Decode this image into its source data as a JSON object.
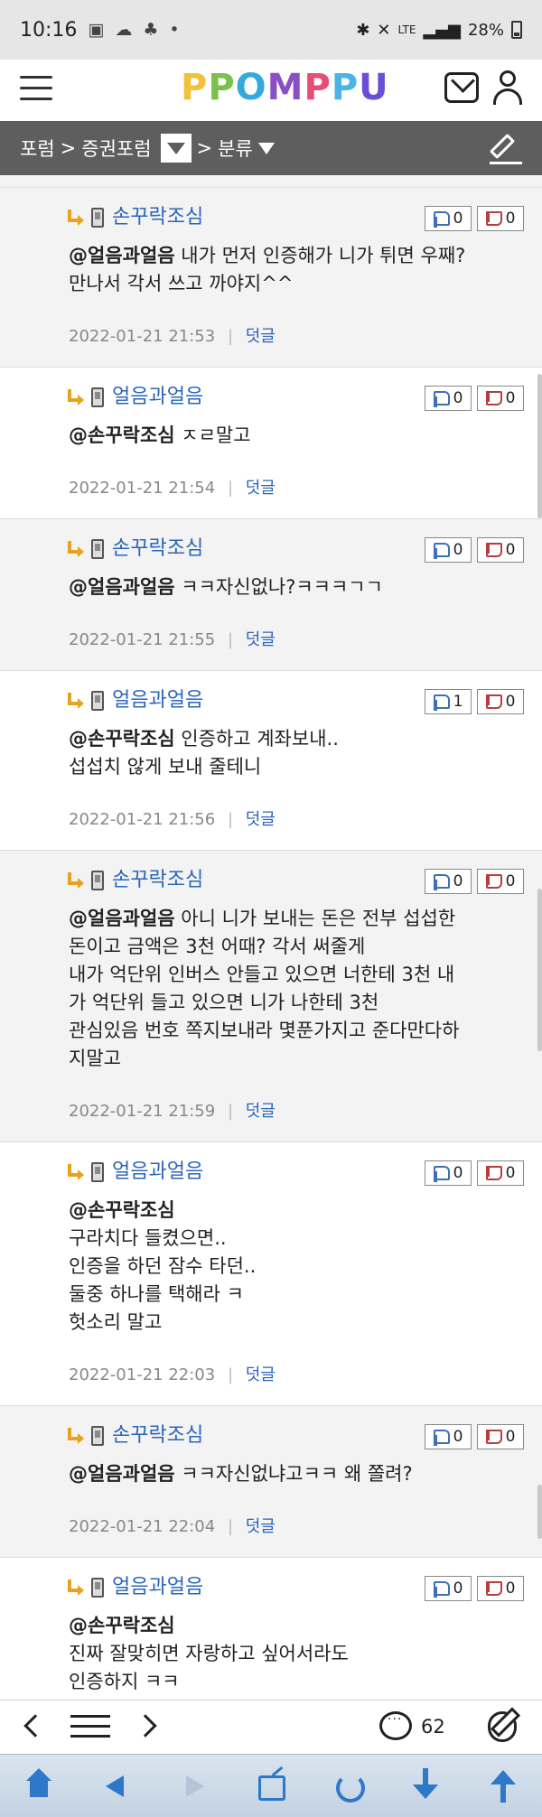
{
  "status_bar": {
    "time": "10:16",
    "battery": "28%",
    "network": "LTE"
  },
  "header": {
    "logo": "PPOMPPU"
  },
  "breadcrumb": {
    "forum": "포럼",
    "sep1": ">",
    "board": "증권포럼",
    "sep2": ">",
    "category": "분류"
  },
  "comments": [
    {
      "nick": "손꾸락조심",
      "mention": "@얼음과얼음",
      "body": " 내가 먼저 인증해가 니가 튀면 우째?\n만나서 각서 쓰고 까야지^^",
      "up": "0",
      "down": "0",
      "time": "2022-01-21 21:53",
      "reply": "덧글"
    },
    {
      "nick": "얼음과얼음",
      "mention": "@손꾸락조심",
      "body": " ㅈㄹ말고",
      "up": "0",
      "down": "0",
      "time": "2022-01-21 21:54",
      "reply": "덧글"
    },
    {
      "nick": "손꾸락조심",
      "mention": "@얼음과얼음",
      "body": " ㅋㅋ자신없나?ㅋㅋㅋㄱㄱ",
      "up": "0",
      "down": "0",
      "time": "2022-01-21 21:55",
      "reply": "덧글"
    },
    {
      "nick": "얼음과얼음",
      "mention": "@손꾸락조심",
      "body": " 인증하고 계좌보내..\n섭섭치 않게 보내 줄테니",
      "up": "1",
      "down": "0",
      "time": "2022-01-21 21:56",
      "reply": "덧글"
    },
    {
      "nick": "손꾸락조심",
      "mention": "@얼음과얼음",
      "body": " 아니 니가 보내는 돈은 전부 섭섭한\n돈이고 금액은 3천 어때? 각서 써줄게\n내가 억단위 인버스 안들고 있으면 너한테 3천 내\n가 억단위 들고 있으면 니가 나한테 3천\n관심있음 번호 쪽지보내라 몇푼가지고 준다만다하\n지말고",
      "up": "0",
      "down": "0",
      "time": "2022-01-21 21:59",
      "reply": "덧글"
    },
    {
      "nick": "얼음과얼음",
      "mention": "@손꾸락조심",
      "body": "\n구라치다 들켰으면..\n인증을 하던 잠수 타던..\n둘중 하나를 택해라 ㅋ\n헛소리 말고",
      "up": "0",
      "down": "0",
      "time": "2022-01-21 22:03",
      "reply": "덧글"
    },
    {
      "nick": "손꾸락조심",
      "mention": "@얼음과얼음",
      "body": " ㅋㅋ자신없냐고ㅋㅋ 왜 쫄려?",
      "up": "0",
      "down": "0",
      "time": "2022-01-21 22:04",
      "reply": "덧글"
    },
    {
      "nick": "얼음과얼음",
      "mention": "@손꾸락조심",
      "body": "\n진짜 잘맞히면 자랑하고 싶어서라도\n인증하지 ㅋㅋ\n구라쟁이",
      "up": "0",
      "down": "0",
      "time": "",
      "reply": ""
    }
  ],
  "toolbar": {
    "comment_count": "62"
  },
  "colors": {
    "nick": "#2b65b9",
    "crumb_bg": "#5e5e5e",
    "nav_bg": "#c3d2e2"
  }
}
